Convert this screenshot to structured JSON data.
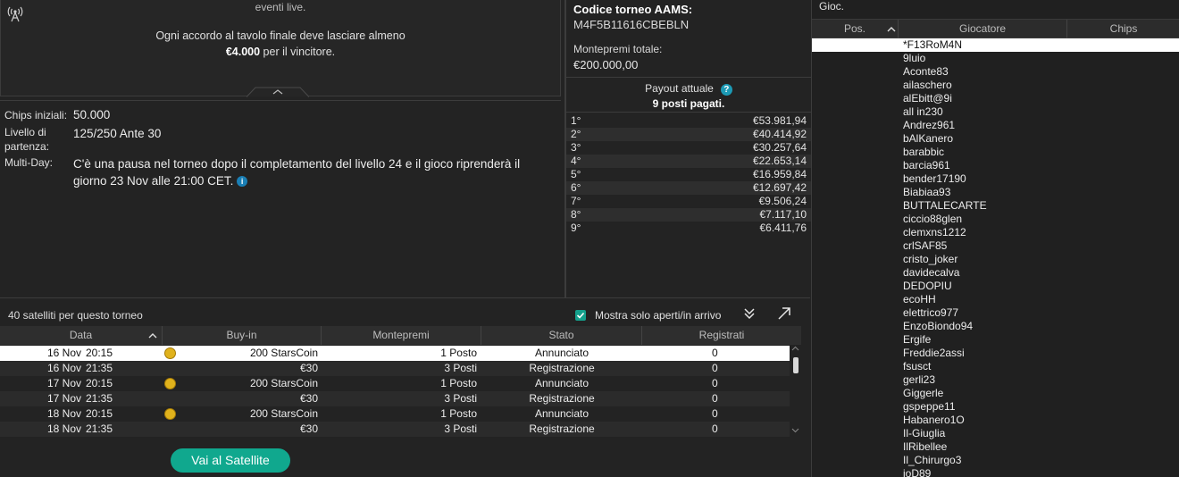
{
  "message": {
    "cut_line": "eventi live.",
    "line1": "Ogni accordo al tavolo finale deve lasciare almeno",
    "amount": "€4.000",
    "line2_rest": " per il vincitore."
  },
  "info": {
    "chips_label": "Chips iniziali:",
    "chips_value": "50.000",
    "level_label_1": "Livello di",
    "level_label_2": "partenza:",
    "level_value": "125/250 Ante 30",
    "multiday_label": "Multi-Day:",
    "multiday_value_1": "C'è una pausa nel torneo dopo il completamento del livello 24 e il gioco riprenderà il",
    "multiday_value_2": "giorno 23 Nov alle 21:00 CET.",
    "info_icon": "i"
  },
  "tournament": {
    "code_title": "Codice torneo AAMS:",
    "code_value": "M4F5B11616CBEBLN",
    "prize_label": "Montepremi totale:",
    "prize_value": "€200.000,00",
    "payout_title": "Payout attuale",
    "help_icon": "?",
    "payout_sub": "9 posti pagati."
  },
  "payouts": [
    {
      "pos": "1°",
      "amount": "€53.981,94"
    },
    {
      "pos": "2°",
      "amount": "€40.414,92"
    },
    {
      "pos": "3°",
      "amount": "€30.257,64"
    },
    {
      "pos": "4°",
      "amount": "€22.653,14"
    },
    {
      "pos": "5°",
      "amount": "€16.959,84"
    },
    {
      "pos": "6°",
      "amount": "€12.697,42"
    },
    {
      "pos": "7°",
      "amount": "€9.506,24"
    },
    {
      "pos": "8°",
      "amount": "€7.117,10"
    },
    {
      "pos": "9°",
      "amount": "€6.411,76"
    }
  ],
  "players": {
    "title": "Gioc.",
    "col_pos": "Pos.",
    "col_player": "Giocatore",
    "col_chips": "Chips",
    "list": [
      "*F13RoM4N",
      "9luio",
      "Aconte83",
      "ailaschero",
      "alEbitt@9i",
      "all in230",
      "Andrez961",
      "bAlKanero",
      "barabbic",
      "barcia961",
      "bender17190",
      "Biabiaa93",
      "BUTTALECARTE",
      "ciccio88glen",
      "clemxns1212",
      "crlSAF85",
      "cristo_joker",
      "davidecalva",
      "DEDOPIU",
      "ecoHH",
      "elettrico977",
      "EnzoBiondo94",
      "Ergife",
      "Freddie2assi",
      "fsusct",
      "gerli23",
      "Giggerle",
      "gspeppe11",
      "Habanero1O",
      "Il-Giuglia",
      "IlRibellee",
      "Il_Chirurgo3",
      "ioD89"
    ]
  },
  "satellites": {
    "count": "40 satelliti per questo torneo",
    "filter_label": "Mostra solo aperti/in arrivo",
    "headers": {
      "date": "Data",
      "buyin": "Buy-in",
      "prize": "Montepremi",
      "status": "Stato",
      "registered": "Registrati"
    },
    "rows": [
      {
        "date": "16 Nov",
        "time": "20:15",
        "buyin": "200 StarsCoin",
        "coin": true,
        "prize": "1 Posto",
        "status": "Annunciato",
        "registered": "0"
      },
      {
        "date": "16 Nov",
        "time": "21:35",
        "buyin": "€30",
        "coin": false,
        "prize": "3 Posti",
        "status": "Registrazione",
        "registered": "0"
      },
      {
        "date": "17 Nov",
        "time": "20:15",
        "buyin": "200 StarsCoin",
        "coin": true,
        "prize": "1 Posto",
        "status": "Annunciato",
        "registered": "0"
      },
      {
        "date": "17 Nov",
        "time": "21:35",
        "buyin": "€30",
        "coin": false,
        "prize": "3 Posti",
        "status": "Registrazione",
        "registered": "0"
      },
      {
        "date": "18 Nov",
        "time": "20:15",
        "buyin": "200 StarsCoin",
        "coin": true,
        "prize": "1 Posto",
        "status": "Annunciato",
        "registered": "0"
      },
      {
        "date": "18 Nov",
        "time": "21:35",
        "buyin": "€30",
        "coin": false,
        "prize": "3 Posti",
        "status": "Registrazione",
        "registered": "0"
      }
    ],
    "button": "Vai al Satellite"
  },
  "colors": {
    "accent": "#10a88e",
    "coin": "#e0b21c",
    "info_blue": "#1a7fb5"
  },
  "icons": [
    "antenna-icon",
    "chevron-up-icon",
    "help-icon",
    "info-icon",
    "checkbox-icon",
    "double-chevron-down-icon",
    "expand-arrow-icon",
    "coin-icon",
    "sort-up-icon"
  ]
}
